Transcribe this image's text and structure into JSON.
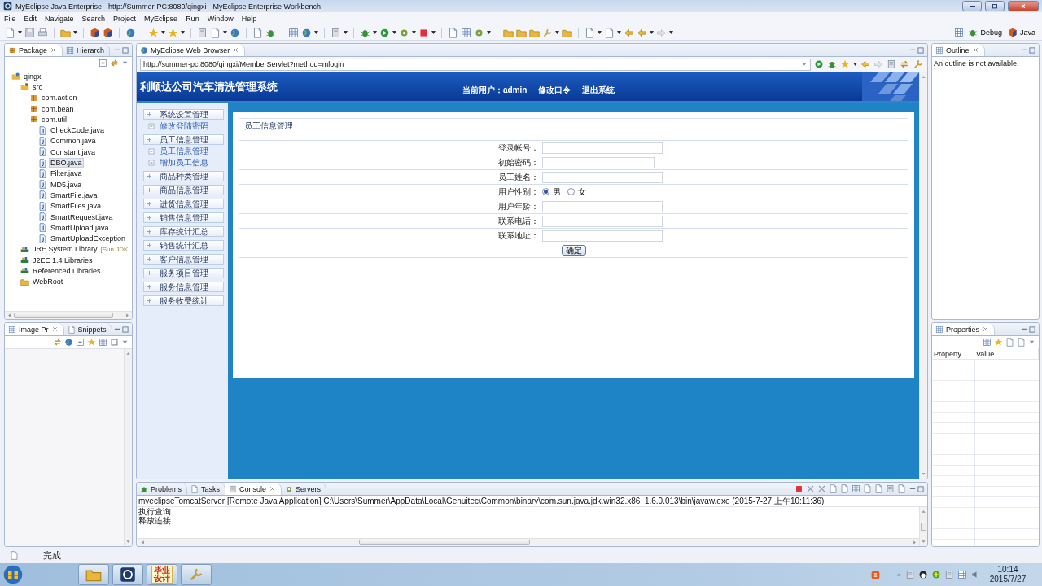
{
  "window": {
    "title": "MyEclipse Java Enterprise - http://Summer-PC:8080/qingxi - MyEclipse Enterprise Workbench"
  },
  "menu": [
    "File",
    "Edit",
    "Navigate",
    "Search",
    "Project",
    "MyEclipse",
    "Run",
    "Window",
    "Help"
  ],
  "perspectives": [
    "Debug",
    "Java"
  ],
  "package_explorer": {
    "tabs": [
      {
        "label": "Package",
        "selected": true
      },
      {
        "label": "Hierarch",
        "selected": false
      }
    ],
    "tree": [
      {
        "label": "qingxi",
        "kind": "project",
        "selected": false,
        "children": [
          {
            "label": "src",
            "kind": "source",
            "selected": false,
            "children": [
              {
                "label": "com.action",
                "kind": "package",
                "selected": false
              },
              {
                "label": "com.bean",
                "kind": "package",
                "selected": false
              },
              {
                "label": "com.util",
                "kind": "package",
                "selected": false,
                "children": [
                  {
                    "label": "CheckCode.java",
                    "kind": "java",
                    "selected": false
                  },
                  {
                    "label": "Common.java",
                    "kind": "java",
                    "selected": false
                  },
                  {
                    "label": "Constant.java",
                    "kind": "java",
                    "selected": false
                  },
                  {
                    "label": "DBO.java",
                    "kind": "java",
                    "selected": true
                  },
                  {
                    "label": "Filter.java",
                    "kind": "java",
                    "selected": false
                  },
                  {
                    "label": "MD5.java",
                    "kind": "java",
                    "selected": false
                  },
                  {
                    "label": "SmartFile.java",
                    "kind": "java",
                    "selected": false
                  },
                  {
                    "label": "SmartFiles.java",
                    "kind": "java",
                    "selected": false
                  },
                  {
                    "label": "SmartRequest.java",
                    "kind": "java",
                    "selected": false
                  },
                  {
                    "label": "SmartUpload.java",
                    "kind": "java",
                    "selected": false
                  },
                  {
                    "label": "SmartUploadException",
                    "kind": "java",
                    "selected": false
                  }
                ]
              }
            ]
          },
          {
            "label": "JRE System Library",
            "decoration": "[Sun JDK",
            "kind": "library",
            "selected": false
          },
          {
            "label": "J2EE 1.4 Libraries",
            "kind": "library",
            "selected": false
          },
          {
            "label": "Referenced Libraries",
            "kind": "library",
            "selected": false
          },
          {
            "label": "WebRoot",
            "kind": "folder",
            "selected": false
          }
        ]
      }
    ]
  },
  "image_preview": {
    "tabs": [
      {
        "label": "Image Pr",
        "selected": true
      },
      {
        "label": "Snippets",
        "selected": false
      }
    ]
  },
  "browser": {
    "tab": "MyEclipse Web Browser",
    "url": "http://summer-pc:8080/qingxi/MemberServlet?method=mlogin",
    "page": {
      "title": "利顺达公司汽车清洗管理系统",
      "user": "当前用户：admin",
      "links": [
        "修改口令",
        "退出系统"
      ],
      "nav": [
        {
          "label": "系统设置管理",
          "kind": "group"
        },
        {
          "label": "修改登陆密码",
          "kind": "link"
        },
        {
          "label": "员工信息管理",
          "kind": "group"
        },
        {
          "label": "员工信息管理",
          "kind": "link"
        },
        {
          "label": "增加员工信息",
          "kind": "link"
        },
        {
          "label": "商品种类管理",
          "kind": "group"
        },
        {
          "label": "商品信息管理",
          "kind": "group"
        },
        {
          "label": "进货信息管理",
          "kind": "group"
        },
        {
          "label": "销售信息管理",
          "kind": "group"
        },
        {
          "label": "库存统计汇总",
          "kind": "group"
        },
        {
          "label": "销售统计汇总",
          "kind": "group"
        },
        {
          "label": "客户信息管理",
          "kind": "group"
        },
        {
          "label": "服务项目管理",
          "kind": "group"
        },
        {
          "label": "服务信息管理",
          "kind": "group"
        },
        {
          "label": "服务收费统计",
          "kind": "group"
        }
      ],
      "panel_title": "员工信息管理",
      "form": [
        {
          "label": "登录帐号：",
          "kind": "text"
        },
        {
          "label": "初始密码：",
          "kind": "password"
        },
        {
          "label": "员工姓名：",
          "kind": "text"
        },
        {
          "label": "用户性别：",
          "kind": "radio",
          "options": [
            {
              "label": "男",
              "selected": true
            },
            {
              "label": "女",
              "selected": false
            }
          ]
        },
        {
          "label": "用户年龄：",
          "kind": "text"
        },
        {
          "label": "联系电话：",
          "kind": "text"
        },
        {
          "label": "联系地址：",
          "kind": "text"
        }
      ],
      "submit": "确定"
    }
  },
  "outline": {
    "tab": "Outline",
    "message": "An outline is not available."
  },
  "properties": {
    "tab": "Properties",
    "columns": [
      "Property",
      "Value"
    ]
  },
  "console": {
    "tabs": [
      {
        "label": "Problems",
        "selected": false
      },
      {
        "label": "Tasks",
        "selected": false
      },
      {
        "label": "Console",
        "selected": true
      },
      {
        "label": "Servers",
        "selected": false
      }
    ],
    "process": "myeclipseTomcatServer [Remote Java Application] C:\\Users\\Summer\\AppData\\Local\\Genuitec\\Common\\binary\\com.sun.java.jdk.win32.x86_1.6.0.013\\bin\\javaw.exe (2015-7-27 上午10:11:36)",
    "lines": [
      "执行查询",
      "释放连接"
    ]
  },
  "status_bar": {
    "text": "完成"
  },
  "taskbar": {
    "badge": [
      "毕业",
      "设计"
    ],
    "time": "10:14",
    "date": "2015/7/27"
  }
}
